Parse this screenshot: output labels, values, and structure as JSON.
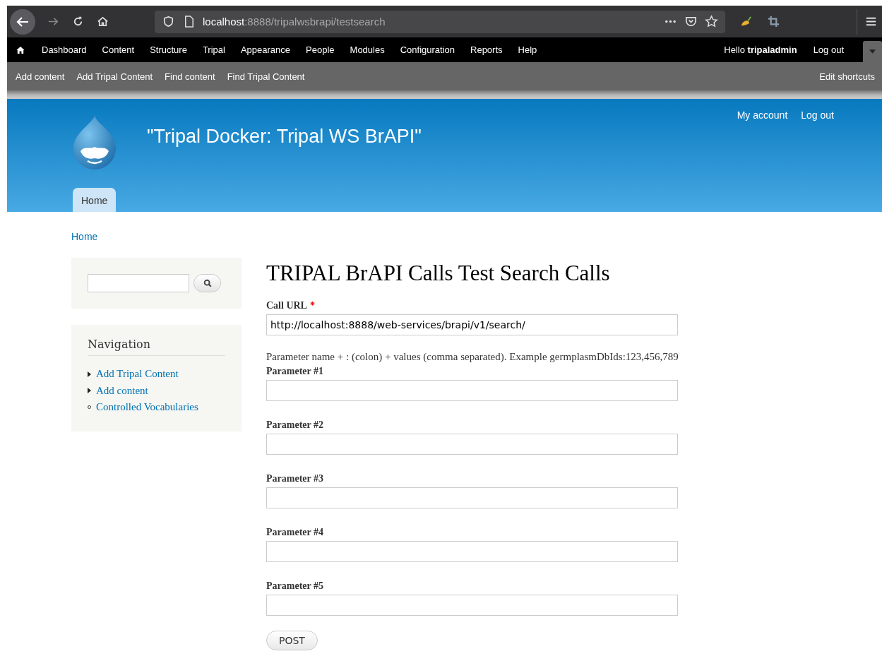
{
  "browser": {
    "url_host": "localhost",
    "url_path": ":8888/tripalwsbrapi/testsearch"
  },
  "admin_menu": [
    {
      "label": "Dashboard"
    },
    {
      "label": "Content"
    },
    {
      "label": "Structure"
    },
    {
      "label": "Tripal"
    },
    {
      "label": "Appearance"
    },
    {
      "label": "People"
    },
    {
      "label": "Modules"
    },
    {
      "label": "Configuration"
    },
    {
      "label": "Reports"
    },
    {
      "label": "Help"
    }
  ],
  "user_greeting": "Hello **tripaladmin**",
  "admin_logout": "Log out",
  "shortcuts": [
    "Add content",
    "Add Tripal Content",
    "Find content",
    "Find Tripal Content"
  ],
  "edit_shortcuts": "Edit shortcuts",
  "site_name": "\"Tripal Docker: Tripal WS BrAPI\"",
  "secondary_menu": [
    "My account",
    "Log out"
  ],
  "main_tabs": [
    {
      "label": "Home",
      "selected": true
    }
  ],
  "breadcrumb": "Home",
  "navigation": {
    "title": "Navigation",
    "items": [
      {
        "label": "Add Tripal Content",
        "kind": "collapsed"
      },
      {
        "label": "Add content",
        "kind": "collapsed"
      },
      {
        "label": "Controlled Vocabularies",
        "kind": "leaf"
      }
    ]
  },
  "page_title": "TRIPAL BrAPI Calls Test Search Calls",
  "call_url": {
    "label": "Call URL",
    "required_mark": "*",
    "value": "http://localhost:8888/web-services/brapi/v1/search/"
  },
  "help_text": "Parameter name + : (colon) + values (comma separated). Example germplasmDbIds:123,456,789",
  "parameters": [
    {
      "label": "Parameter #1"
    },
    {
      "label": "Parameter #2"
    },
    {
      "label": "Parameter #3"
    },
    {
      "label": "Parameter #4"
    },
    {
      "label": "Parameter #5"
    }
  ],
  "submit": "POST"
}
